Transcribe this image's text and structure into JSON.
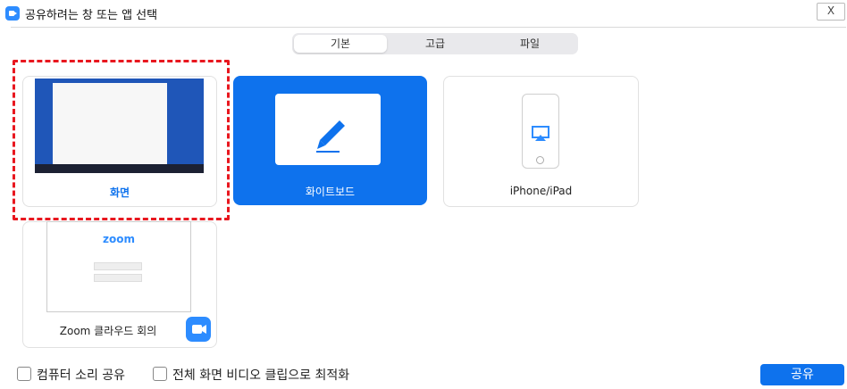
{
  "window": {
    "title": "공유하려는 창 또는 앱 선택",
    "close_label": "X"
  },
  "tabs": [
    {
      "label": "기본",
      "active": true
    },
    {
      "label": "고급",
      "active": false
    },
    {
      "label": "파일",
      "active": false
    }
  ],
  "cards": {
    "screen": {
      "label": "화면",
      "selected": true
    },
    "whiteboard": {
      "label": "화이트보드"
    },
    "iphone": {
      "label": "iPhone/iPad"
    },
    "zoom_cloud": {
      "label": "Zoom 클라우드 회의",
      "logo_text": "zoom"
    }
  },
  "footer": {
    "share_sound": "컴퓨터 소리 공유",
    "optimize_video": "전체 화면 비디오 클립으로 최적화",
    "share_button": "공유"
  },
  "colors": {
    "accent": "#0E72ED",
    "zoom_blue": "#2D8CFF",
    "selection": "#E8171F"
  },
  "icons": [
    "zoom-app-icon",
    "pencil-icon",
    "airplay-icon",
    "camera-icon"
  ]
}
